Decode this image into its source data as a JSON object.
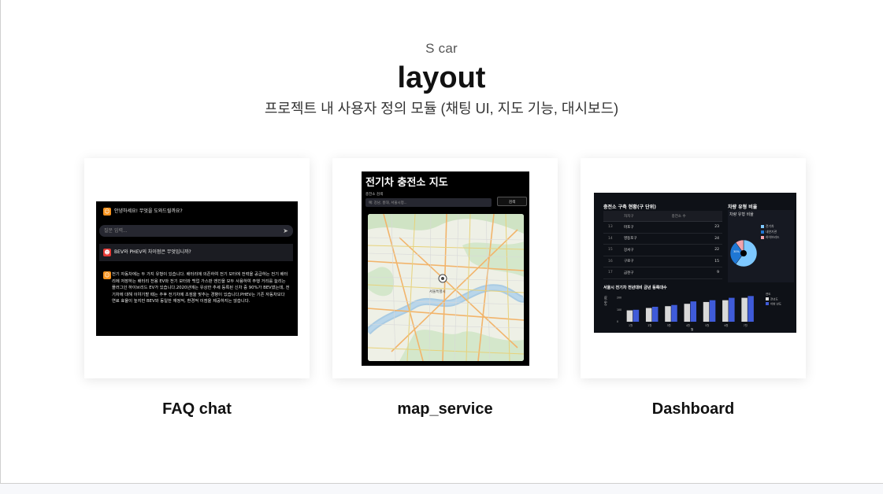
{
  "header": {
    "eyebrow": "S car",
    "title": "layout",
    "subtitle": "프로젝트 내 사용자 정의 모듈 (채팅 UI, 지도 기능, 대시보드)"
  },
  "cards": [
    {
      "label": "FAQ chat",
      "preview": {
        "greeting": "안녕하세요! 무엇을 도와드릴까요?",
        "input_placeholder": "질문 입력...",
        "user_question": "BEV와 PHEV의 차이점은 무엇입니까?",
        "answer": "전기 자동차에는 두 가지 유형이 있습니다. 배터리에 의존하여 전기 모터에 전력을 공급하는 전기 배터리에 저장하는 배터리 전용 EV와 전기 모터와 백업 가스판 엔진을 모두 사용하여 주행 거리를 늘리는 플러그인 하이브리드 EV가 있습니다.2020년에는 유상한 추세 등록된 신차 중 90%가 BEV였는데, 전기차에 대해 이야기할 때는 추후 전기차에 초점을 맞추는 경향이 있습니다.PHEV는 기존 자동차보다 연료 효율이 높지만 BEV와 동일한 재정적, 환경적 이점을 제공하지는 않습니다."
      }
    },
    {
      "label": "map_service",
      "preview": {
        "title": "전기차 충전소 지도",
        "search_label": "충전소 검색",
        "search_placeholder": "예: 강남, 홍대, 서울시청...",
        "search_button": "검색",
        "map_labels": [
          "서울특별시"
        ]
      }
    },
    {
      "label": "Dashboard",
      "preview": {
        "table_title": "충전소 구축 현황(구 단위)",
        "table_headers": [
          "자치구",
          "충전소 수"
        ],
        "table_rows": [
          {
            "idx": "13",
            "name": "마포구",
            "value": "23"
          },
          {
            "idx": "14",
            "name": "영등포구",
            "value": "24"
          },
          {
            "idx": "15",
            "name": "강서구",
            "value": "22"
          },
          {
            "idx": "16",
            "name": "구로구",
            "value": "15"
          },
          {
            "idx": "17",
            "name": "금천구",
            "value": "9"
          }
        ],
        "pie_title": "차량 유형 비율",
        "pie_subtitle": "차량 유형 비율",
        "bar_title": "서울시 전기차 전년대비 금년 등록대수",
        "bar_xlabel": "월",
        "bar_ylabel": "수량 (대)",
        "bar_legend_title": "연도",
        "colors": {
          "series_a": "#d9d9d9",
          "series_b": "#3f5bd9",
          "pie_a": "#7ec8ff",
          "pie_b": "#1f77d4",
          "pie_c": "#f3a3ad"
        }
      }
    }
  ],
  "chart_data": [
    {
      "type": "pie",
      "title": "차량 유형 비율",
      "labels": [
        "전기차",
        "내연기관",
        "하이브리드"
      ],
      "values": [
        60,
        30,
        10
      ],
      "data_labels": [
        "30%"
      ]
    },
    {
      "type": "bar",
      "title": "서울시 전기차 전년대비 금년 등록대수",
      "categories": [
        "1월",
        "2월",
        "3월",
        "4월",
        "5월",
        "6월",
        "7월"
      ],
      "xlabel": "월",
      "ylabel": "수량 (대)",
      "yticks": [
        "0",
        "100",
        "200"
      ],
      "series": [
        {
          "name": "전년도",
          "values": [
            95,
            115,
            130,
            150,
            165,
            180,
            200
          ]
        },
        {
          "name": "이번 년도",
          "values": [
            100,
            125,
            140,
            170,
            180,
            200,
            215
          ]
        }
      ],
      "ylim": [
        0,
        250
      ]
    }
  ]
}
